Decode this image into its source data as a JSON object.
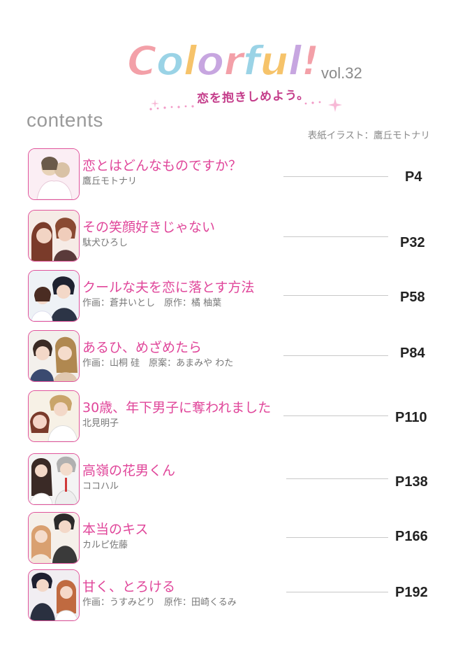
{
  "header": {
    "logo_text": "Colorful!",
    "volume": "vol.32",
    "tagline": "恋を抱きしめよう。",
    "contents_label": "contents",
    "cover_credit": "表紙イラスト：鷹丘モトナリ"
  },
  "colors": {
    "title_pink": "#e0469a",
    "thumb_border": "#e0549b",
    "logo_letters": [
      "#f3a0a8",
      "#9ad3e6",
      "#f6c36a",
      "#c7a6e0",
      "#f3a0a8",
      "#9ad3e6",
      "#f6c36a",
      "#c7a6e0",
      "#f3a0a8"
    ]
  },
  "entries": [
    {
      "title": "恋とはどんなものですか？",
      "author": "鷹丘モトナリ",
      "page": "P4"
    },
    {
      "title": "その笑顔好きじゃない",
      "author": "駄犬ひろし",
      "page": "P32"
    },
    {
      "title": "クールな夫を恋に落とす方法",
      "author": "作画：蒼井いとし　原作：橘 柚葉",
      "page": "P58"
    },
    {
      "title": "あるひ、めざめたら",
      "author": "作画：山桐 硅　原案：あまみや わた",
      "page": "P84"
    },
    {
      "title": "30歳、年下男子に奪われました",
      "author": "北見明子",
      "page": "P110"
    },
    {
      "title": "高嶺の花男くん",
      "author": "ココハル",
      "page": "P138"
    },
    {
      "title": "本当のキス",
      "author": "カルピ佐藤",
      "page": "P166"
    },
    {
      "title": "甘く、とろける",
      "author": "作画：うすみどり　原作：田崎くるみ",
      "page": "P192"
    }
  ]
}
